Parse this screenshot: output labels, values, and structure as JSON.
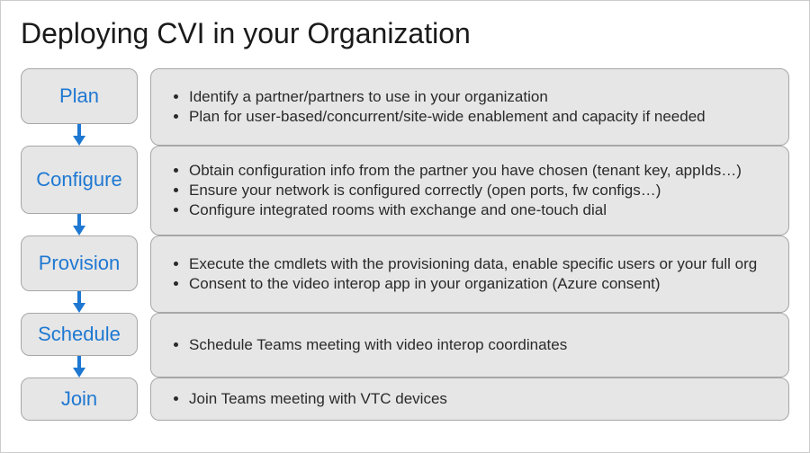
{
  "title": "Deploying CVI in your Organization",
  "stages": {
    "plan": {
      "label": "Plan",
      "bullets": [
        "Identify a partner/partners to use in your organization",
        "Plan for user-based/concurrent/site-wide enablement and capacity if needed"
      ]
    },
    "configure": {
      "label": "Configure",
      "bullets": [
        "Obtain configuration info from the partner you have chosen (tenant key, appIds…)",
        "Ensure your network is configured correctly (open ports, fw configs…)",
        "Configure integrated rooms with exchange and one-touch dial"
      ]
    },
    "provision": {
      "label": "Provision",
      "bullets": [
        "Execute the cmdlets with the provisioning data, enable specific users or your full org",
        "Consent to the video interop app in your organization (Azure consent)"
      ]
    },
    "schedule": {
      "label": "Schedule",
      "bullets": [
        "Schedule Teams meeting with video interop coordinates"
      ]
    },
    "join": {
      "label": "Join",
      "bullets": [
        "Join Teams meeting with VTC devices"
      ]
    }
  },
  "colors": {
    "accent": "#1e78d2",
    "box_bg": "#e6e6e6",
    "box_border": "#a7a7a7"
  }
}
